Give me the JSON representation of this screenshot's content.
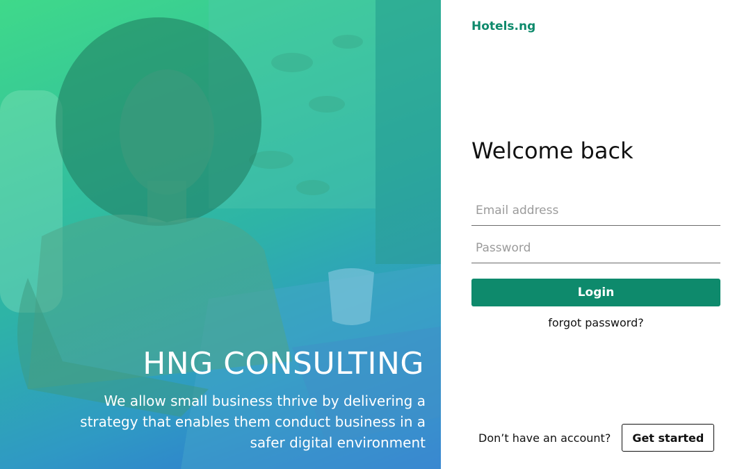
{
  "hero": {
    "title": "HNG CONSULTING",
    "tagline": "We allow small business thrive by delivering a strategy that enables them conduct business in a safer digital environment"
  },
  "panel": {
    "brand": "Hotels.ng",
    "welcome": "Welcome back",
    "email_placeholder": "Email address",
    "password_placeholder": "Password",
    "login_label": "Login",
    "forgot_label": "forgot password?",
    "no_account_text": "Don’t have an account?",
    "get_started_label": "Get started"
  },
  "colors": {
    "brand_green": "#0e8a6c",
    "hero_gradient_start": "#3fd98a",
    "hero_gradient_end": "#2f6fd6"
  }
}
